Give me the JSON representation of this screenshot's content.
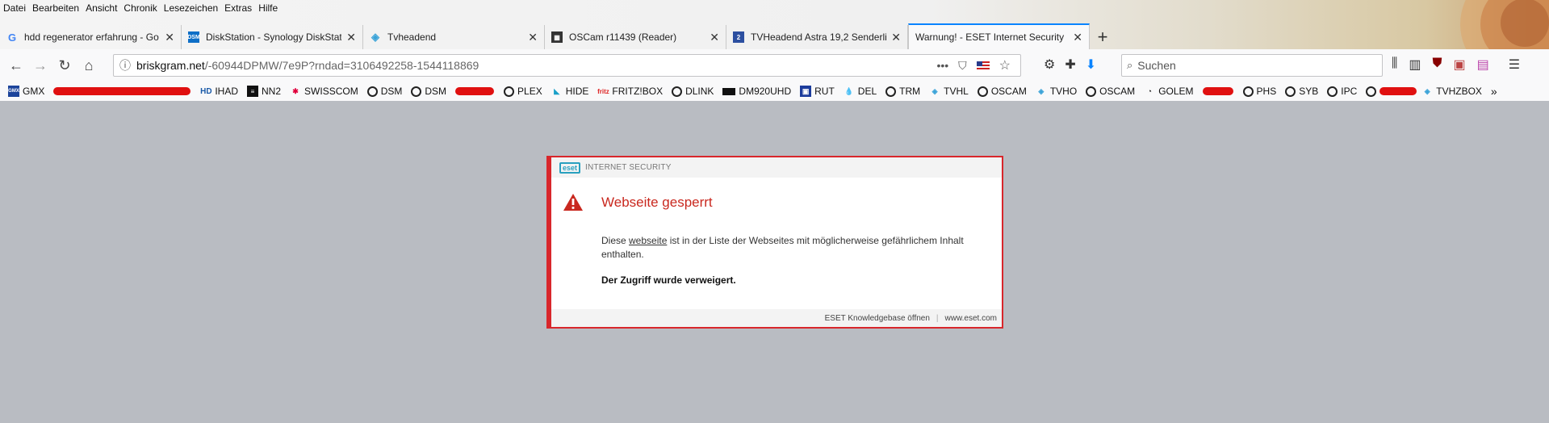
{
  "menubar": [
    "Datei",
    "Bearbeiten",
    "Ansicht",
    "Chronik",
    "Lesezeichen",
    "Extras",
    "Hilfe"
  ],
  "tabs": [
    {
      "title": "hdd regenerator erfahrung - Go",
      "icon": "google-icon",
      "active": false
    },
    {
      "title": "DiskStation - Synology DiskStat",
      "icon": "dsm-icon",
      "active": false
    },
    {
      "title": "Tvheadend",
      "icon": "tvheadend-icon",
      "active": false
    },
    {
      "title": "OSCam r11439 (Reader)",
      "icon": "oscam-icon",
      "active": false
    },
    {
      "title": "TVHeadend Astra 19,2 Senderli",
      "icon": "tvh-astra-icon",
      "active": false
    },
    {
      "title": "Warnung! - ESET Internet Security",
      "icon": "",
      "active": true
    }
  ],
  "new_tab_label": "+",
  "url": {
    "host": "briskgram.net",
    "path": "/-60944DPMW/7e9P?rndad=3106492258-1544118869"
  },
  "search_placeholder": "Suchen",
  "bookmarks": [
    {
      "label": "GMX",
      "icon": "gmx-icon"
    },
    {
      "label": "IHAD",
      "icon": "ihad-icon"
    },
    {
      "label": "NN2",
      "icon": "nn2-icon"
    },
    {
      "label": "SWISSCOM",
      "icon": "swisscom-icon"
    },
    {
      "label": "DSM",
      "icon": "globe-icon"
    },
    {
      "label": "DSM",
      "icon": "globe-icon"
    },
    {
      "label": "PLEX",
      "icon": "globe-icon"
    },
    {
      "label": "HIDE",
      "icon": "hide-icon"
    },
    {
      "label": "FRITZ!BOX",
      "icon": "fritzbox-icon"
    },
    {
      "label": "DLINK",
      "icon": "globe-icon"
    },
    {
      "label": "DM920UHD",
      "icon": "dm920-icon"
    },
    {
      "label": "RUT",
      "icon": "rut-icon"
    },
    {
      "label": "DEL",
      "icon": "del-icon"
    },
    {
      "label": "TRM",
      "icon": "globe-icon"
    },
    {
      "label": "TVHL",
      "icon": "tvheadend-icon"
    },
    {
      "label": "OSCAM",
      "icon": "globe-icon"
    },
    {
      "label": "TVHO",
      "icon": "tvheadend-icon"
    },
    {
      "label": "OSCAM",
      "icon": "globe-icon"
    },
    {
      "label": "GOLEM",
      "icon": "rss-icon"
    },
    {
      "label": "PHS",
      "icon": "globe-icon"
    },
    {
      "label": "SYB",
      "icon": "globe-icon"
    },
    {
      "label": "IPC",
      "icon": "globe-icon"
    },
    {
      "label": "TVHZBOX",
      "icon": "tvheadend-icon"
    }
  ],
  "dialog": {
    "logo": "eset",
    "product": "INTERNET SECURITY",
    "title": "Webseite gesperrt",
    "msg_pre": "Diese ",
    "msg_link": "webseite",
    "msg_post": " ist in der Liste der Webseites mit möglicherweise gefährlichem Inhalt enthalten.",
    "denied": "Der Zugriff wurde verweigert.",
    "footer_link": "ESET Knowledgebase öffnen",
    "footer_sep": "|",
    "footer_site": "www.eset.com"
  },
  "colors": {
    "accent": "#0a84ff",
    "eset_red": "#d8262b",
    "page_bg": "#b9bcc2",
    "eset_teal": "#29a0bf"
  }
}
